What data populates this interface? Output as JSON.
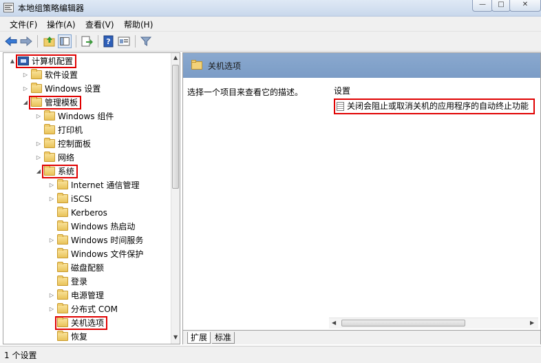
{
  "window": {
    "title": "本地组策略编辑器",
    "controls": {
      "minimize": "—",
      "maximize": "□",
      "close": "✕"
    }
  },
  "menu": [
    "文件(F)",
    "操作(A)",
    "查看(V)",
    "帮助(H)"
  ],
  "toolbar": {
    "icons": [
      "back-arrow-icon",
      "forward-arrow-icon",
      "up-folder-icon",
      "show-hide-tree-icon",
      "export-list-icon",
      "help-icon",
      "properties-icon",
      "filter-icon"
    ]
  },
  "tree": [
    {
      "label": "计算机配置",
      "icon": "computer-icon",
      "expander": "▲",
      "highlighted": true
    },
    {
      "label": "软件设置",
      "icon": "folder-icon",
      "expander": "▷",
      "highlighted": false
    },
    {
      "label": "Windows 设置",
      "icon": "folder-icon",
      "expander": "▷",
      "highlighted": false
    },
    {
      "label": "管理模板",
      "icon": "folder-icon",
      "expander": "◢",
      "highlighted": true
    },
    {
      "label": "Windows 组件",
      "icon": "folder-icon",
      "expander": "▷",
      "highlighted": false
    },
    {
      "label": "打印机",
      "icon": "folder-icon",
      "expander": "",
      "highlighted": false
    },
    {
      "label": "控制面板",
      "icon": "folder-icon",
      "expander": "▷",
      "highlighted": false
    },
    {
      "label": "网络",
      "icon": "folder-icon",
      "expander": "▷",
      "highlighted": false
    },
    {
      "label": "系统",
      "icon": "folder-icon",
      "expander": "◢",
      "highlighted": true
    },
    {
      "label": "Internet 通信管理",
      "icon": "folder-icon",
      "expander": "▷",
      "highlighted": false
    },
    {
      "label": "iSCSI",
      "icon": "folder-icon",
      "expander": "▷",
      "highlighted": false
    },
    {
      "label": "Kerberos",
      "icon": "folder-icon",
      "expander": "",
      "highlighted": false
    },
    {
      "label": "Windows 热启动",
      "icon": "folder-icon",
      "expander": "",
      "highlighted": false
    },
    {
      "label": "Windows 时间服务",
      "icon": "folder-icon",
      "expander": "▷",
      "highlighted": false
    },
    {
      "label": "Windows 文件保护",
      "icon": "folder-icon",
      "expander": "",
      "highlighted": false
    },
    {
      "label": "磁盘配额",
      "icon": "folder-icon",
      "expander": "",
      "highlighted": false
    },
    {
      "label": "登录",
      "icon": "folder-icon",
      "expander": "",
      "highlighted": false
    },
    {
      "label": "电源管理",
      "icon": "folder-icon",
      "expander": "▷",
      "highlighted": false
    },
    {
      "label": "分布式 COM",
      "icon": "folder-icon",
      "expander": "▷",
      "highlighted": false
    },
    {
      "label": "关机选项",
      "icon": "folder-icon",
      "expander": "",
      "highlighted": true
    },
    {
      "label": "恢复",
      "icon": "folder-icon",
      "expander": "",
      "highlighted": false
    }
  ],
  "right": {
    "header": "关机选项",
    "description": "选择一个项目来查看它的描述。",
    "settings_header": "设置",
    "setting_item": "关闭会阻止或取消关机的应用程序的自动终止功能"
  },
  "tabs": [
    "扩展",
    "标准"
  ],
  "status": "1 个设置",
  "colors": {
    "highlight": "#e00000",
    "header": "#7b9cc6"
  }
}
